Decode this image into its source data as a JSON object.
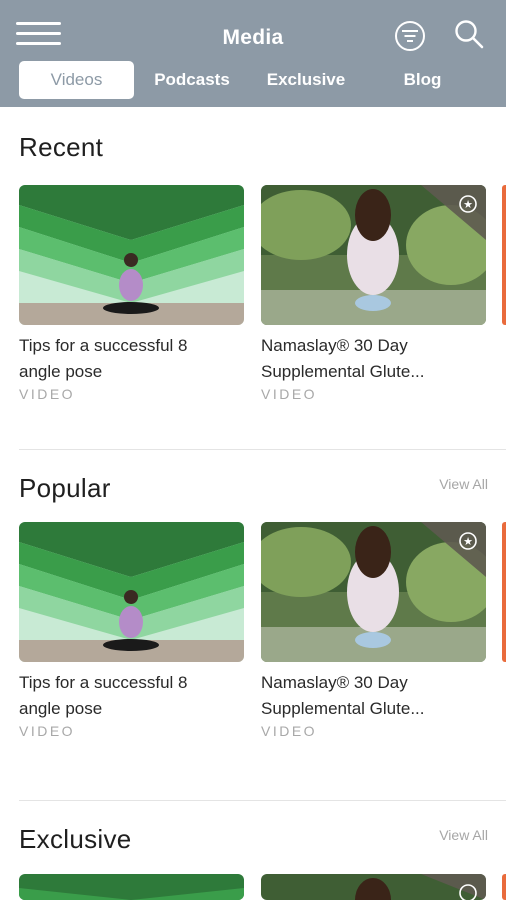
{
  "header": {
    "title": "Media",
    "tabs": [
      {
        "label": "Videos",
        "active": true
      },
      {
        "label": "Podcasts",
        "active": false
      },
      {
        "label": "Exclusive",
        "active": false
      },
      {
        "label": "Blog",
        "active": false
      }
    ],
    "icons": [
      "menu-icon",
      "filter-icon",
      "search-icon"
    ]
  },
  "colors": {
    "header_bg": "#8d9aa6",
    "text": "#222222",
    "muted": "#a8a8a8"
  },
  "sections": [
    {
      "title": "Recent",
      "view_all": "",
      "cards": [
        {
          "title_line1": "Tips for a successful 8",
          "title_line2": "angle pose",
          "kind": "VIDEO",
          "thumb": "yoga-green-wall",
          "exclusive": false
        },
        {
          "title_line1": "Namaslay® 30 Day",
          "title_line2": "Supplemental Glute...",
          "kind": "VIDEO",
          "thumb": "yoga-forest",
          "exclusive": true
        }
      ]
    },
    {
      "title": "Popular",
      "view_all": "View All",
      "cards": [
        {
          "title_line1": "Tips for a successful 8",
          "title_line2": "angle pose",
          "kind": "VIDEO",
          "thumb": "yoga-green-wall",
          "exclusive": false
        },
        {
          "title_line1": "Namaslay® 30 Day",
          "title_line2": "Supplemental Glute...",
          "kind": "VIDEO",
          "thumb": "yoga-forest",
          "exclusive": true
        }
      ]
    },
    {
      "title": "Exclusive",
      "view_all": "View All",
      "cards": [
        {
          "title_line1": "",
          "title_line2": "",
          "kind": "",
          "thumb": "yoga-green-wall",
          "exclusive": false
        },
        {
          "title_line1": "",
          "title_line2": "",
          "kind": "",
          "thumb": "yoga-forest",
          "exclusive": true
        }
      ]
    }
  ]
}
